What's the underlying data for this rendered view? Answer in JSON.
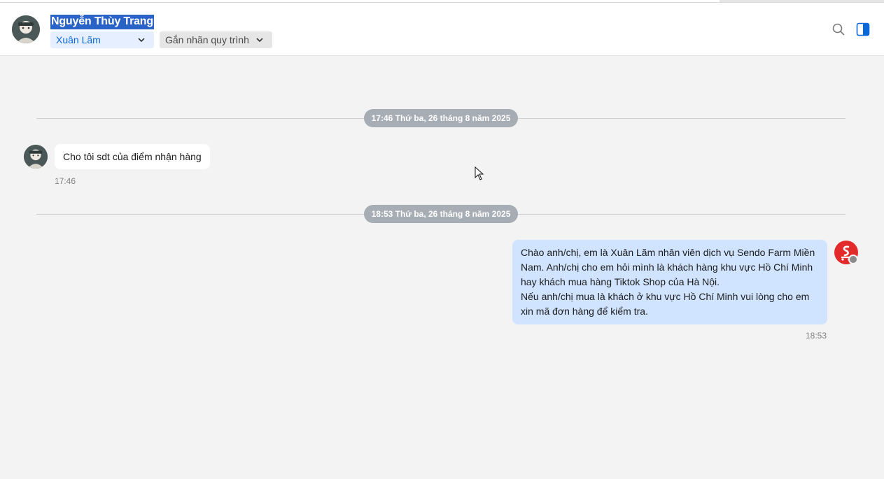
{
  "header": {
    "contact_name": "Nguyễn Thùy Trang",
    "assignee": "Xuân Lãm",
    "tag_placeholder": "Gắn nhãn quy trình",
    "icons": [
      "search-icon",
      "side-panel-icon",
      "chevron-down-icon"
    ]
  },
  "conversation": {
    "separators": [
      {
        "label": "17:46 Thứ ba, 26 tháng 8 năm 2025"
      },
      {
        "label": "18:53 Thứ ba, 26 tháng 8 năm 2025"
      }
    ],
    "incoming": {
      "text": "Cho tôi sdt của điểm nhận hàng",
      "time": "17:46"
    },
    "outgoing": {
      "lines": [
        "Chào anh/chị, em là Xuân Lãm nhân viên dịch vụ Sendo Farm Miền",
        "Nam. Anh/chị cho em hỏi mình là khách hàng khu vực Hồ Chí Minh",
        "hay khách mua hàng Tiktok Shop của Hà Nội.",
        "Nếu anh/chị mua là khách ở khu vực Hồ Chí Minh vui lòng cho em",
        "xin mã đơn hàng để kiểm tra."
      ],
      "time": "18:53"
    }
  },
  "colors": {
    "accent": "#0a68d8",
    "outgoing_bubble": "#d0e4ff",
    "incoming_bubble": "#ffffff",
    "date_pill": "#a7adb5",
    "brand_avatar": "#e32a2a",
    "selection": "#2a63c7"
  }
}
